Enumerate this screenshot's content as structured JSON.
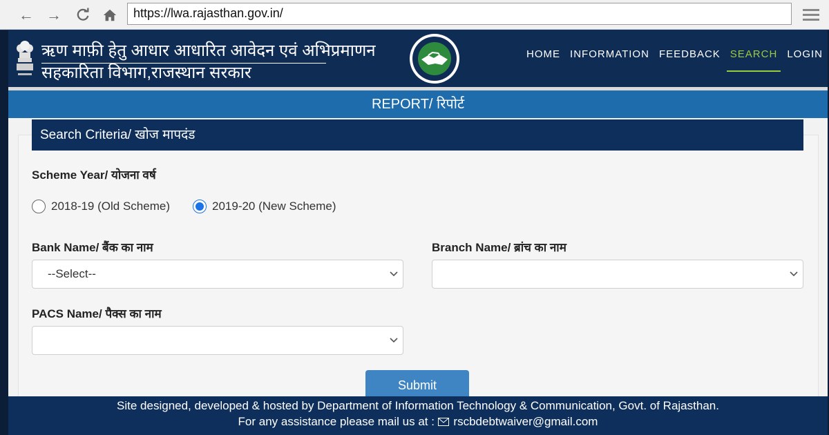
{
  "browser": {
    "url": "https://lwa.rajasthan.gov.in/"
  },
  "header": {
    "title_line1": "ऋण माफ़ी हेतु आधार आधारित आवेदन एवं अभिप्रमाणन",
    "title_line2": "सहकारिता विभाग,राजस्थान सरकार",
    "nav": [
      {
        "label": "HOME"
      },
      {
        "label": "INFORMATION"
      },
      {
        "label": "FEEDBACK"
      },
      {
        "label": "SEARCH",
        "active": true
      },
      {
        "label": "LOGIN"
      }
    ]
  },
  "report_title": "REPORT/ रिपोर्ट",
  "card": {
    "header": "Search Criteria/ खोज मापदंड",
    "scheme_label": "Scheme Year/ योजना वर्ष",
    "options": [
      {
        "label": "2018-19 (Old Scheme)",
        "checked": false
      },
      {
        "label": "2019-20 (New Scheme)",
        "checked": true
      }
    ],
    "bank_label": "Bank Name/ बैंक का नाम",
    "bank_value": "--Select--",
    "branch_label": "Branch Name/ ब्रांच का नाम",
    "branch_value": "",
    "pacs_label": "PACS Name/ पैक्स का नाम",
    "pacs_value": "",
    "submit_label": "Submit"
  },
  "footer": {
    "line1": "Site designed, developed & hosted by Department of Information Technology & Communication, Govt. of Rajasthan.",
    "line2_prefix": "For any assistance please mail us at :",
    "email": "rscbdebtwaiver@gmail.com"
  },
  "colors": {
    "navy": "#0f2c55",
    "accent_green": "#9ccc3c",
    "report_blue": "#1f6cad",
    "button_blue": "#3f84c3",
    "radio_blue": "#1a73e8"
  }
}
